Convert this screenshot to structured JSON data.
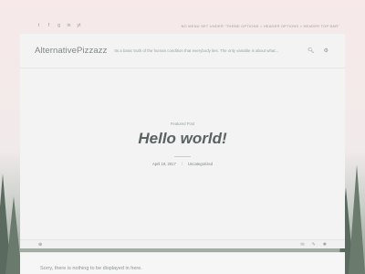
{
  "topbar": {
    "socials": [
      "t",
      "f",
      "g",
      "in",
      "yt"
    ],
    "nav": [
      "No menu set under \"Theme Options > Header Options > Header Top Bar\""
    ]
  },
  "header": {
    "site_title": "AlternativePizzazz",
    "tagline": "Its a basic truth of the human condition that everybody lies. The only variable is about what...",
    "icons": [
      "search-icon",
      "gear-icon"
    ]
  },
  "hero": {
    "featured_label": "Featured Post",
    "post_title": "Hello world!",
    "date": "April 19, 2017",
    "separator": "/",
    "category": "Uncategorized"
  },
  "strip": {
    "left_icon": "⊕",
    "right_icons": [
      "✉",
      "✎",
      "✱"
    ]
  },
  "footer": {
    "empty_message": "Sorry, there is nothing to be displayed in here."
  },
  "colors": {
    "accent": "#5a6262",
    "background_top": "#f7e9e9",
    "forest": "#5b6a5e"
  }
}
